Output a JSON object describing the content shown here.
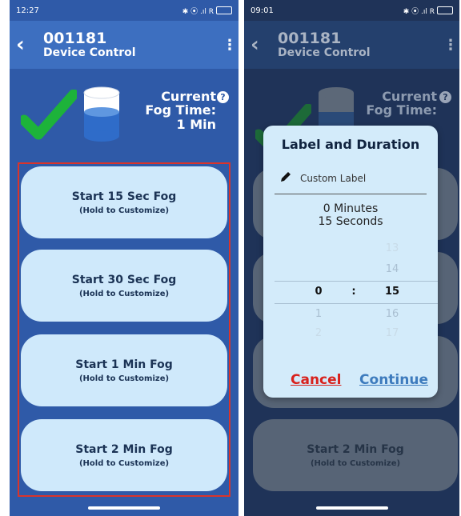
{
  "left": {
    "status": {
      "time": "12:27",
      "icons": "✱ ⦿ .ıl R"
    },
    "appbar": {
      "device_id": "001181",
      "subtitle": "Device Control"
    },
    "fog": {
      "line1": "Current",
      "line2": "Fog Time:",
      "line3": "1 Min"
    },
    "buttons": [
      {
        "label": "Start 15 Sec Fog",
        "hint": "(Hold to Customize)"
      },
      {
        "label": "Start 30 Sec Fog",
        "hint": "(Hold to Customize)"
      },
      {
        "label": "Start 1 Min Fog",
        "hint": "(Hold to Customize)"
      },
      {
        "label": "Start 2 Min Fog",
        "hint": "(Hold to Customize)"
      }
    ]
  },
  "right": {
    "status": {
      "time": "09:01",
      "icons": "✱ ⦿ .ıl R"
    },
    "appbar": {
      "device_id": "001181",
      "subtitle": "Device Control"
    },
    "fog": {
      "line1": "Current",
      "line2": "Fog Time:"
    },
    "bg_button": {
      "label": "Start 2 Min Fog",
      "hint": "(Hold to Customize)"
    },
    "dialog": {
      "title": "Label and Duration",
      "label_placeholder": "Custom Label",
      "duration_line1": "0 Minutes",
      "duration_line2": "15 Seconds",
      "picker": {
        "colon": ":",
        "rows": [
          {
            "min": "",
            "sec": "13"
          },
          {
            "min": "",
            "sec": "14"
          },
          {
            "min": "0",
            "sec": "15"
          },
          {
            "min": "1",
            "sec": "16"
          },
          {
            "min": "2",
            "sec": "17"
          }
        ]
      },
      "cancel": "Cancel",
      "continue": "Continue"
    }
  },
  "colors": {
    "accent": "#3d7bbd",
    "check": "#1db33a",
    "cancel": "#d8211c",
    "highlight_border": "#d9342b",
    "button_bg": "#cfe9fb"
  }
}
